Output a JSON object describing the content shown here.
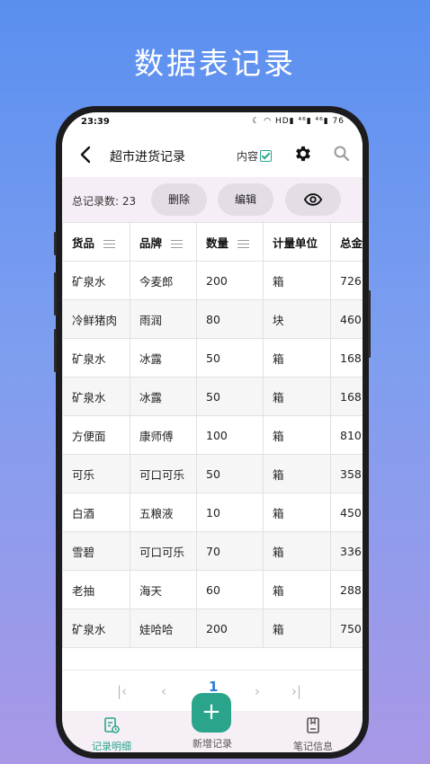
{
  "headline": "数据表记录",
  "status_bar": {
    "time": "23:39",
    "indicators": "☾ ◠ HD▮ ⁴⁶▮ ⁴⁶▮ 76"
  },
  "appbar": {
    "title": "超市进货记录",
    "content_label": "内容"
  },
  "toolbar": {
    "count_label": "总记录数: 23",
    "delete": "删除",
    "edit": "编辑"
  },
  "table": {
    "columns": [
      "货品",
      "品牌",
      "数量",
      "计量单位",
      "总金"
    ],
    "rows": [
      [
        "矿泉水",
        "今麦郎",
        "200",
        "箱",
        "726"
      ],
      [
        "冷鲜猪肉",
        "雨润",
        "80",
        "块",
        "460"
      ],
      [
        "矿泉水",
        "冰露",
        "50",
        "箱",
        "168"
      ],
      [
        "矿泉水",
        "冰露",
        "50",
        "箱",
        "168"
      ],
      [
        "方便面",
        "康师傅",
        "100",
        "箱",
        "810"
      ],
      [
        "可乐",
        "可口可乐",
        "50",
        "箱",
        "358"
      ],
      [
        "白酒",
        "五粮液",
        "10",
        "箱",
        "450"
      ],
      [
        "雪碧",
        "可口可乐",
        "70",
        "箱",
        "336"
      ],
      [
        "老抽",
        "海天",
        "60",
        "箱",
        "288"
      ],
      [
        "矿泉水",
        "娃哈哈",
        "200",
        "箱",
        "750"
      ]
    ]
  },
  "pager": {
    "first": "|‹",
    "prev": "‹",
    "page": "1",
    "next": "›",
    "last": "›|"
  },
  "nav": {
    "records": "记录明细",
    "add": "新增记录",
    "notes": "笔记信息",
    "fab": "+"
  },
  "colors": {
    "accent": "#2aa58c",
    "page_link": "#2a7cd6"
  }
}
